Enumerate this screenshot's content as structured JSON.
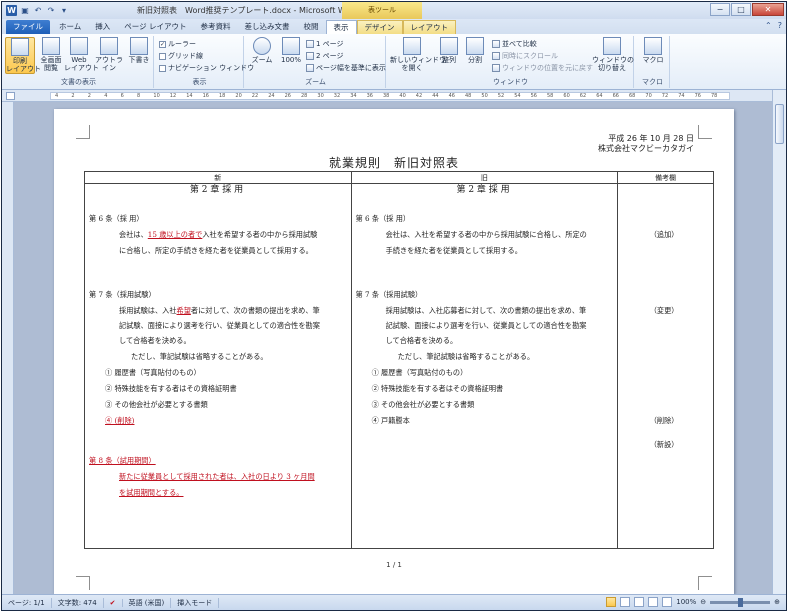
{
  "window": {
    "title": "新旧対照表　Word推奨テンプレート.docx - Microsoft Word",
    "context_tab_group": "表ツール",
    "min": "−",
    "max": "□",
    "close": "✕"
  },
  "tabs": [
    "ファイル",
    "ホーム",
    "挿入",
    "ページ レイアウト",
    "参考資料",
    "差し込み文書",
    "校閲",
    "表示",
    "デザイン",
    "レイアウト"
  ],
  "ribbon": {
    "doc_view": {
      "label": "文書の表示",
      "buttons": [
        "印刷\nレイアウト",
        "全画面\n閲覧",
        "Web\nレイアウト",
        "アウトライン",
        "下書き"
      ]
    },
    "show": {
      "label": "表示",
      "ruler": "ルーラー",
      "gridlines": "グリッド線",
      "nav": "ナビゲーション ウィンドウ"
    },
    "zoom": {
      "label": "ズーム",
      "zoom": "ズーム",
      "zoom100": "100%",
      "one_page": "1 ページ",
      "two_pages": "2 ページ",
      "page_width": "ページ幅を基準に表示"
    },
    "window": {
      "label": "ウィンドウ",
      "new_window": "新しいウィンドウ\nを開く",
      "arrange": "整列",
      "split": "分割",
      "side_by_side": "並べて比較",
      "sync_scroll": "同時にスクロール",
      "reset_pos": "ウィンドウの位置を元に戻す",
      "switch": "ウィンドウの\n切り替え"
    },
    "macro": {
      "label": "マクロ",
      "macro": "マクロ"
    }
  },
  "ruler": {
    "ticks": [
      "4",
      "2",
      "2",
      "4",
      "6",
      "8",
      "10",
      "12",
      "14",
      "16",
      "18",
      "20",
      "22",
      "24",
      "26",
      "28",
      "30",
      "32",
      "34",
      "36",
      "38",
      "40",
      "42",
      "44",
      "46",
      "48",
      "50",
      "52",
      "54",
      "56",
      "58",
      "60",
      "62",
      "64",
      "66",
      "68",
      "70",
      "72",
      "74",
      "76",
      "78"
    ]
  },
  "document": {
    "date": "平成 26 年 10 月 28 日",
    "company": "株式会社マクビーカタガイ",
    "title": "就業規則　新旧対照表",
    "headers": {
      "new": "新",
      "old": "旧",
      "notes": "備考欄"
    },
    "new_col": {
      "chapter": "第 2 章 採 用",
      "art6_title": "第 6 条（採 用）",
      "art6_l1_pre": "会社は、",
      "art6_l1_red": "15 歳以上の者で",
      "art6_l1_post": "入社を希望する者の中から採用試験",
      "art6_l2": "に合格し、所定の手続きを経た者を従業員として採用する。",
      "art7_title": "第 7 条（採用試験）",
      "art7_l1_pre": "採用試験は、入社",
      "art7_l1_red": "希望",
      "art7_l1_post": "者に対して、次の書類の提出を求め、筆",
      "art7_l2": "記試験、面接により選考を行い、従業員としての適合性を勘案",
      "art7_l3": "して合格者を決める。",
      "art7_l4": "ただし、筆記試験は省略することがある。",
      "item1": "①  履歴書（写真貼付のもの）",
      "item2": "②  特殊技能を有する者はその資格証明書",
      "item3": "③  その他会社が必要とする書類",
      "item4": "④  (削除)",
      "art8_title": "第 8 条（試用期間）",
      "art8_l1": "新たに従業員として採用された者は、入社の日より 3 ヶ月間",
      "art8_l2": "を試用期間とする。"
    },
    "old_col": {
      "chapter": "第 2 章 採 用",
      "art6_title": "第 6 条（採 用）",
      "art6_l1": "会社は、入社を希望する者の中から採用試験に合格し、所定の",
      "art6_l2": "手続きを経た者を従業員として採用する。",
      "art7_title": "第 7 条（採用試験）",
      "art7_l1": "採用試験は、入社応募者に対して、次の書類の提出を求め、筆",
      "art7_l2": "記試験、面接により選考を行い、従業員としての適合性を勘案",
      "art7_l3": "して合格者を決める。",
      "art7_l4": "ただし、筆記試験は省略することがある。",
      "item1": "①  履歴書（写真貼付のもの）",
      "item2": "②  特殊技能を有する者はその資格証明書",
      "item3": "③  その他会社が必要とする書類",
      "item4": "④  戸籍謄本"
    },
    "notes": {
      "n1": "（追加）",
      "n2": "（変更）",
      "n3": "（削除）",
      "n4": "（新設）"
    },
    "page_number": "1 / 1"
  },
  "status": {
    "page": "ページ: 1/1",
    "words": "文字数: 474",
    "lang": "英語 (米国)",
    "mode": "挿入モード",
    "zoom": "100%"
  }
}
